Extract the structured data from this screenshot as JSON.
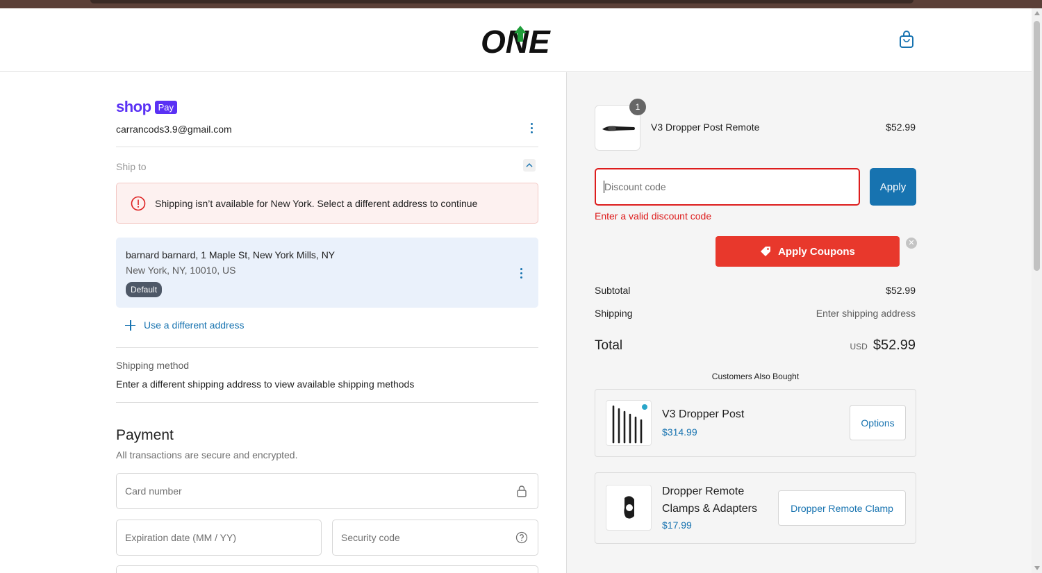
{
  "header": {
    "logo_text": "ONE",
    "logo_icon": "one-up-logo-icon",
    "cart_icon": "shopping-bag-icon"
  },
  "colors": {
    "accent": "#1773b0",
    "error": "#dd1d1d",
    "shoppay": "#5a31f4",
    "coupon": "#e8382c"
  },
  "contact": {
    "shop_label": "shop",
    "pay_label": "Pay",
    "email": "carrancods3.9@gmail.com"
  },
  "ship_to": {
    "label": "Ship to",
    "error": "Shipping isn’t available for New York. Select a different address to continue",
    "address_line1": "barnard barnard, 1 Maple St, New York Mills, NY",
    "address_line2": "New York, NY, 10010, US",
    "default_badge": "Default",
    "use_different": "Use a different address"
  },
  "shipping_method": {
    "label": "Shipping method",
    "message": "Enter a different shipping address to view available shipping methods"
  },
  "payment": {
    "title": "Payment",
    "subtitle": "All transactions are secure and encrypted.",
    "card_number_placeholder": "Card number",
    "expiration_placeholder": "Expiration date (MM / YY)",
    "security_placeholder": "Security code"
  },
  "order": {
    "item": {
      "quantity": "1",
      "name": "V3 Dropper Post Remote",
      "price": "$52.99"
    },
    "discount_placeholder": "Discount code",
    "apply_label": "Apply",
    "discount_error": "Enter a valid discount code",
    "apply_coupons_label": "Apply Coupons",
    "subtotal_label": "Subtotal",
    "subtotal_value": "$52.99",
    "shipping_label": "Shipping",
    "shipping_value": "Enter shipping address",
    "total_label": "Total",
    "currency": "USD",
    "total_value": "$52.99"
  },
  "upsell": {
    "title": "Customers Also Bought",
    "items": [
      {
        "name": "V3 Dropper Post",
        "price": "$314.99",
        "button": "Options"
      },
      {
        "name_line1": "Dropper Remote",
        "name_line2": "Clamps & Adapters",
        "price": "$17.99",
        "button": "Dropper Remote Clamp"
      }
    ]
  }
}
